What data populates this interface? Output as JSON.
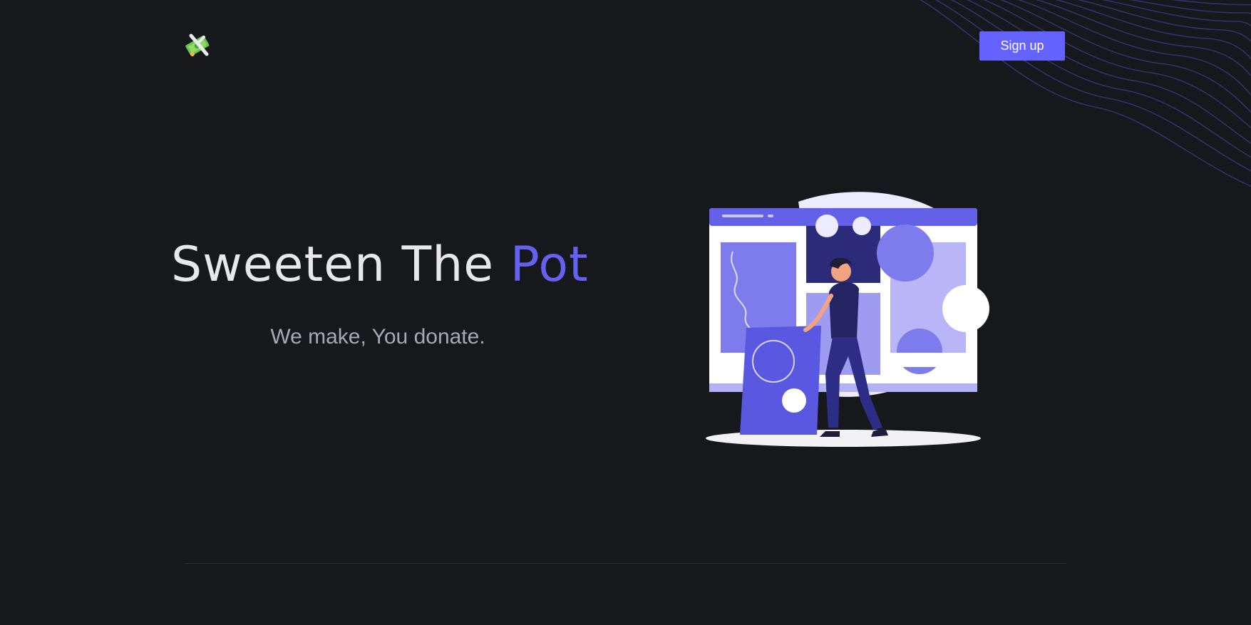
{
  "header": {
    "logo_icon": "money-rocket-icon",
    "signup_label": "Sign up"
  },
  "hero": {
    "title_part1": "Sweeten The",
    "title_accent": "Pot",
    "subtitle": "We make, You donate.",
    "illustration": "person-arranging-gallery-board-illustration"
  },
  "colors": {
    "background": "#17181b",
    "accent": "#6563ff",
    "title_text": "#e8e8ea",
    "subtitle_text": "#a6a9b0"
  }
}
